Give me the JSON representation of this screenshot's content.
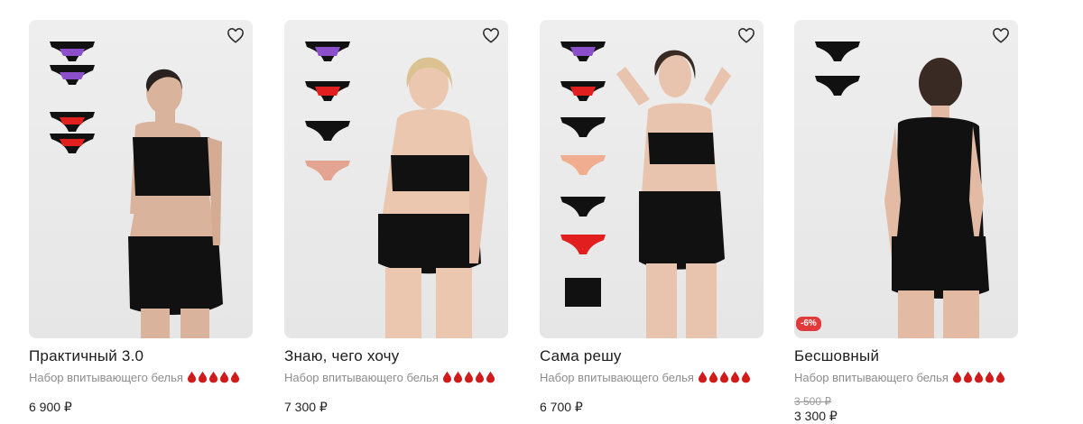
{
  "products": [
    {
      "title": "Практичный 3.0",
      "subtitle": "Набор впитывающего белья",
      "price": "6 900 ₽"
    },
    {
      "title": "Знаю, чего хочу",
      "subtitle": "Набор впитывающего белья",
      "price": "7 300 ₽"
    },
    {
      "title": "Сама решу",
      "subtitle": "Набор впитывающего белья",
      "price": "6 700 ₽"
    },
    {
      "title": "Бесшовный",
      "subtitle": "Набор впитывающего белья",
      "old_price": "3 500 ₽",
      "price": "3 300 ₽",
      "badge": "-6%"
    }
  ],
  "absorbency_drops": 5,
  "colors": {
    "drop": "#d11a1a",
    "badge": "#e03a3a",
    "price": "#222222",
    "subtitle": "#8d8d8d"
  },
  "icons": {
    "favorite": "heart-outline-icon",
    "absorbency": "drop-icon"
  }
}
